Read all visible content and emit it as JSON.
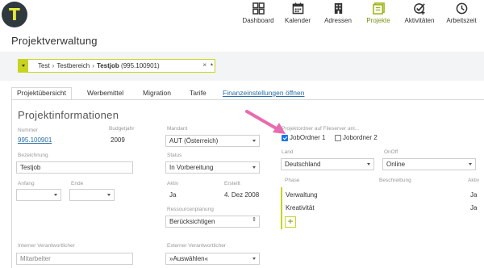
{
  "app": {
    "logo_letter": "T"
  },
  "nav": [
    {
      "label": "Dashboard",
      "icon": "dashboard-icon"
    },
    {
      "label": "Kalender",
      "icon": "calendar-icon"
    },
    {
      "label": "Adressen",
      "icon": "building-icon"
    },
    {
      "label": "Projekte",
      "icon": "projects-icon",
      "active": true
    },
    {
      "label": "Aktivitäten",
      "icon": "activity-check-icon"
    },
    {
      "label": "Arbeitszeit",
      "icon": "clock-icon"
    }
  ],
  "page_title": "Projektverwaltung",
  "breadcrumb": {
    "items": [
      "Test",
      "Testbereich",
      "Testjob"
    ],
    "job_number": "(995.100901)",
    "separator": "›",
    "clear": "×",
    "caret": "▴"
  },
  "tabs": [
    {
      "label": "Projektübersicht",
      "active": true
    },
    {
      "label": "Werbemittel"
    },
    {
      "label": "Migration"
    },
    {
      "label": "Tarife"
    },
    {
      "label": "Finanzeinstellungen öffnen",
      "link": true
    }
  ],
  "section_title": "Projektinformationen",
  "fields": {
    "nummer": {
      "label": "Nummer",
      "value": "995.100901"
    },
    "budgetjahr": {
      "label": "Budgetjahr",
      "value": "2009"
    },
    "mandant": {
      "label": "Mandant",
      "value": "AUT (Österreich)"
    },
    "bezeichnung": {
      "label": "Bezeichnung",
      "value": "Testjob"
    },
    "status": {
      "label": "Status",
      "value": "In Vorbereitung"
    },
    "anfang": {
      "label": "Anfang",
      "value": ""
    },
    "ende": {
      "label": "Ende",
      "value": ""
    },
    "aktiv": {
      "label": "Aktiv",
      "value": "Ja"
    },
    "erstellt": {
      "label": "Erstellt",
      "value": "4. Dez 2008"
    },
    "ressourcenplanung": {
      "label": "Ressourcenplanung",
      "value": "Berücksichtigen"
    },
    "interner": {
      "label": "Interner Verantwortlicher",
      "value": "Mitarbeiter"
    },
    "externer": {
      "label": "Externer Verantwortlicher",
      "value": "»Auswählen«"
    }
  },
  "fileserver": {
    "label": "Projektordner auf Fileserver anl...",
    "options": [
      {
        "label": "JobOrdner 1",
        "checked": true
      },
      {
        "label": "Jobordner 2",
        "checked": false
      }
    ]
  },
  "land": {
    "label": "Land",
    "value": "Deutschland"
  },
  "onoff": {
    "label": "OnOff",
    "value": "Online"
  },
  "phases": {
    "columns": [
      "Phase",
      "Beschreibung",
      "Aktiv"
    ],
    "rows": [
      {
        "phase": "Verwaltung",
        "beschreibung": "",
        "aktiv": "Ja"
      },
      {
        "phase": "Kreativität",
        "beschreibung": "",
        "aktiv": "Ja"
      }
    ],
    "add_label": "+"
  },
  "colors": {
    "accent": "#c7d41f",
    "arrow": "#e86bb0",
    "link": "#2a6ea6",
    "logo_bg": "#2f3a3e"
  }
}
